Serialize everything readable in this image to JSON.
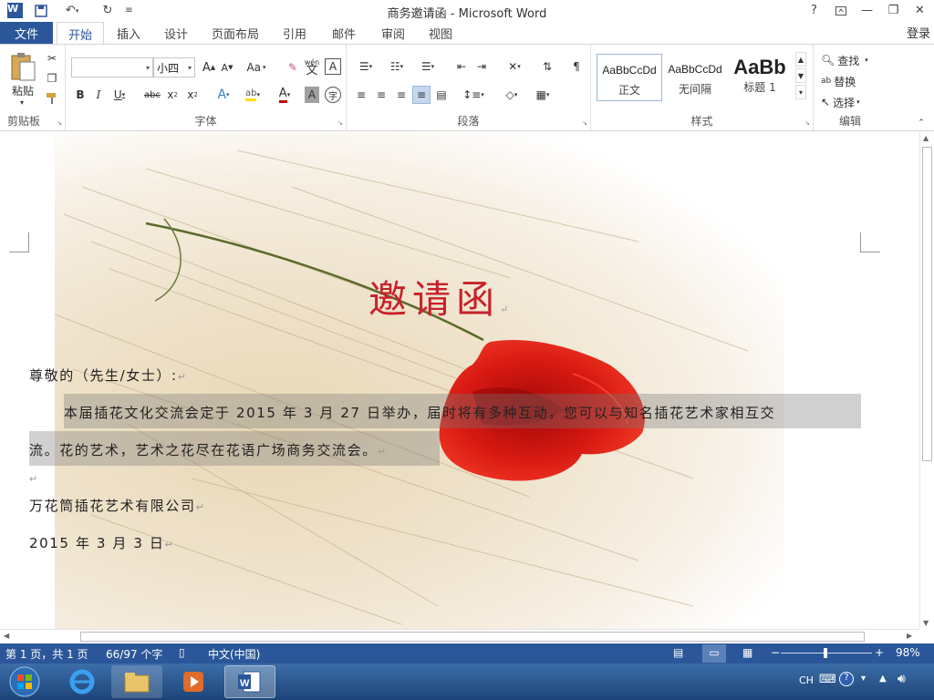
{
  "window": {
    "title": "商务邀请函 - Microsoft Word",
    "help": "?",
    "login": "登录"
  },
  "tabs": [
    {
      "label": "文件"
    },
    {
      "label": "开始"
    },
    {
      "label": "插入"
    },
    {
      "label": "设计"
    },
    {
      "label": "页面布局"
    },
    {
      "label": "引用"
    },
    {
      "label": "邮件"
    },
    {
      "label": "审阅"
    },
    {
      "label": "视图"
    }
  ],
  "ribbon": {
    "clipboard": {
      "paste": "粘贴",
      "label": "剪贴板"
    },
    "font": {
      "name": "",
      "size": "小四",
      "label": "字体",
      "case": "Aa",
      "phonetic": "wén"
    },
    "paragraph": {
      "label": "段落"
    },
    "styles": {
      "label": "样式",
      "items": [
        {
          "sample": "AaBbCcDd",
          "name": "正文"
        },
        {
          "sample": "AaBbCcDd",
          "name": "无间隔"
        },
        {
          "sample": "AaBb",
          "name": "标题 1"
        }
      ]
    },
    "editing": {
      "find": "查找",
      "replace": "替换",
      "select": "选择",
      "label": "编辑"
    }
  },
  "document": {
    "title": "邀请函",
    "salutation": "尊敬的（先生/女士）:",
    "body_line1": "本届插花文化交流会定于 2015 年 3 月 27 日举办，届时将有多种互动，您可以与知名插花艺术家相互交",
    "body_line2": "流。花的艺术，艺术之花尽在花语广场商务交流会。",
    "company": "万花筒插花艺术有限公司",
    "date": "2015 年 3 月 3 日"
  },
  "status": {
    "page": "第 1 页，共 1 页",
    "words": "66/97 个字",
    "language": "中文(中国)",
    "zoom_label": "98%",
    "zoom": 98
  },
  "taskbar": {
    "ime": "CH"
  },
  "colors": {
    "accent": "#2b579a",
    "title_red": "#c8202a"
  }
}
